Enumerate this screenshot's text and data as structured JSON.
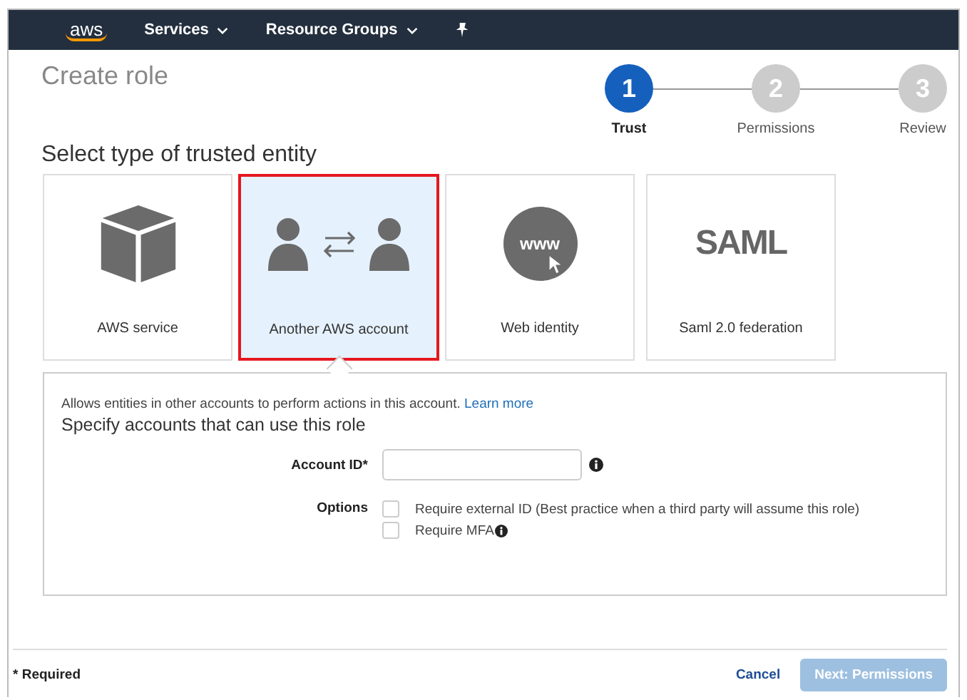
{
  "nav": {
    "logo": "aws",
    "items": [
      {
        "label": "Services",
        "dropdown": true
      },
      {
        "label": "Resource Groups",
        "dropdown": true
      }
    ]
  },
  "title": "Create role",
  "steps": [
    {
      "number": "1",
      "label": "Trust",
      "selected": true
    },
    {
      "number": "2",
      "label": "Permissions",
      "selected": false
    },
    {
      "number": "3",
      "label": "Review",
      "selected": false
    }
  ],
  "section_title": "Select type of trusted entity",
  "entities": [
    {
      "kind": "box",
      "label": "AWS service",
      "selected": false
    },
    {
      "kind": "accounts",
      "label": "Another AWS account",
      "selected": true
    },
    {
      "kind": "globe",
      "icon_text": "www",
      "label": "Web identity",
      "selected": false
    },
    {
      "kind": "saml",
      "icon_text": "SAML",
      "label": "Saml 2.0 federation",
      "selected": false
    }
  ],
  "panel": {
    "description": "Allows entities in other accounts to perform actions in this account.",
    "link": "Learn more",
    "heading": "Specify accounts that can use this role",
    "account_id": {
      "label": "Account ID*"
    },
    "options": {
      "label": "Options",
      "items": [
        {
          "label": "Require external ID (Best practice when a third party will assume this role)",
          "checked": false,
          "info": false
        },
        {
          "label": "Require MFA",
          "checked": false,
          "info": true
        }
      ]
    }
  },
  "footer": {
    "note": "* Required",
    "cancel": "Cancel",
    "next": {
      "label": "Next: Permissions",
      "disabled": true
    }
  }
}
